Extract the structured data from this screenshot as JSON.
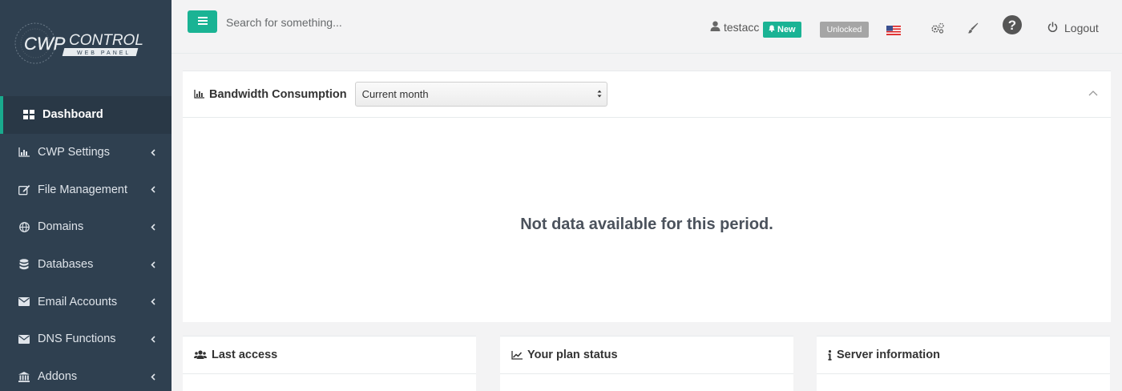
{
  "logo": {
    "text_main": "CWP",
    "text_control": "CONTROL",
    "text_sub": "WEB PANEL"
  },
  "sidebar": {
    "items": [
      {
        "label": "Dashboard",
        "icon": "dashboard-grid-icon",
        "active": true
      },
      {
        "label": "CWP Settings",
        "icon": "bar-chart-icon"
      },
      {
        "label": "File Management",
        "icon": "edit-icon"
      },
      {
        "label": "Domains",
        "icon": "globe-icon"
      },
      {
        "label": "Databases",
        "icon": "database-icon"
      },
      {
        "label": "Email Accounts",
        "icon": "envelope-icon"
      },
      {
        "label": "DNS Functions",
        "icon": "envelope-icon"
      },
      {
        "label": "Addons",
        "icon": "bank-icon"
      }
    ]
  },
  "topbar": {
    "search_placeholder": "Search for something...",
    "username": "testacc",
    "new_badge": "New",
    "unlocked_badge": "Unlocked",
    "logout_label": "Logout"
  },
  "bandwidth": {
    "title": "Bandwidth Consumption",
    "period_selected": "Current month",
    "empty_message": "Not data available for this period."
  },
  "panels": {
    "last_access": "Last access",
    "plan_status": "Your plan status",
    "server_info": "Server information"
  },
  "colors": {
    "accent": "#1ab394",
    "sidebar": "#2f4050",
    "badge_grey": "#a5a5a5"
  }
}
